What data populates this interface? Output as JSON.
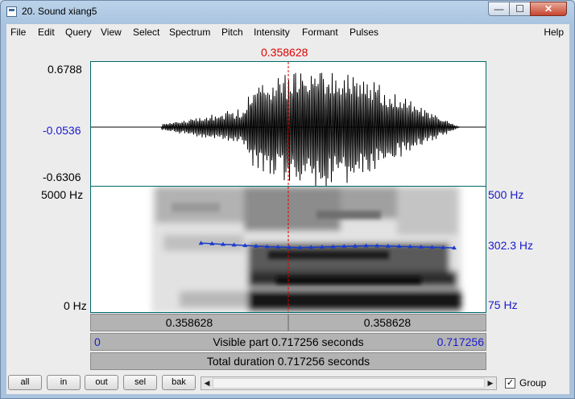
{
  "window": {
    "title": "20. Sound xiang5",
    "minimize_label": "—",
    "maximize_label": "☐",
    "close_label": "✕"
  },
  "menu": [
    "File",
    "Edit",
    "Query",
    "View",
    "Select",
    "Spectrum",
    "Pitch",
    "Intensity",
    "Formant",
    "Pulses"
  ],
  "menu_help": "Help",
  "cursor": {
    "time_label": "0.358628",
    "time": 0.358628
  },
  "waveform": {
    "max_label": "0.6788",
    "cursor_value_label": "-0.0536",
    "min_label": "-0.6306"
  },
  "spectrogram": {
    "freq_max_label": "5000 Hz",
    "freq_min_label": "0 Hz",
    "pitch_max_label": "500 Hz",
    "pitch_cursor_label": "302.3 Hz",
    "pitch_min_label": "75 Hz"
  },
  "pitch_track": {
    "times": [
      0.2,
      0.22,
      0.24,
      0.26,
      0.28,
      0.3,
      0.32,
      0.34,
      0.36,
      0.38,
      0.4,
      0.42,
      0.44,
      0.46,
      0.48,
      0.5,
      0.52,
      0.54,
      0.56,
      0.58,
      0.6,
      0.62,
      0.64,
      0.66
    ],
    "hz": [
      310,
      308,
      306,
      304,
      302,
      300,
      298,
      297,
      296,
      295,
      296,
      297,
      298,
      299,
      300,
      301,
      301,
      300,
      299,
      298,
      297,
      296,
      295,
      294
    ]
  },
  "time_bars": {
    "left_segment": "0.358628",
    "right_segment": "0.358628",
    "visible_start": "0",
    "visible_label": "Visible part 0.717256 seconds",
    "visible_end": "0.717256",
    "total_label": "Total duration 0.717256 seconds"
  },
  "buttons": {
    "all": "all",
    "in": "in",
    "out": "out",
    "sel": "sel",
    "bak": "bak"
  },
  "scroll": {
    "left_arrow": "◀",
    "right_arrow": "▶"
  },
  "group": {
    "label": "Group",
    "checked": true,
    "check_glyph": "✓"
  },
  "total_duration": 0.717256,
  "colors": {
    "cursor": "#e00000",
    "pitch": "#1a3ccc",
    "frame": "#006a6a",
    "axis_blue": "#1a1acc"
  }
}
